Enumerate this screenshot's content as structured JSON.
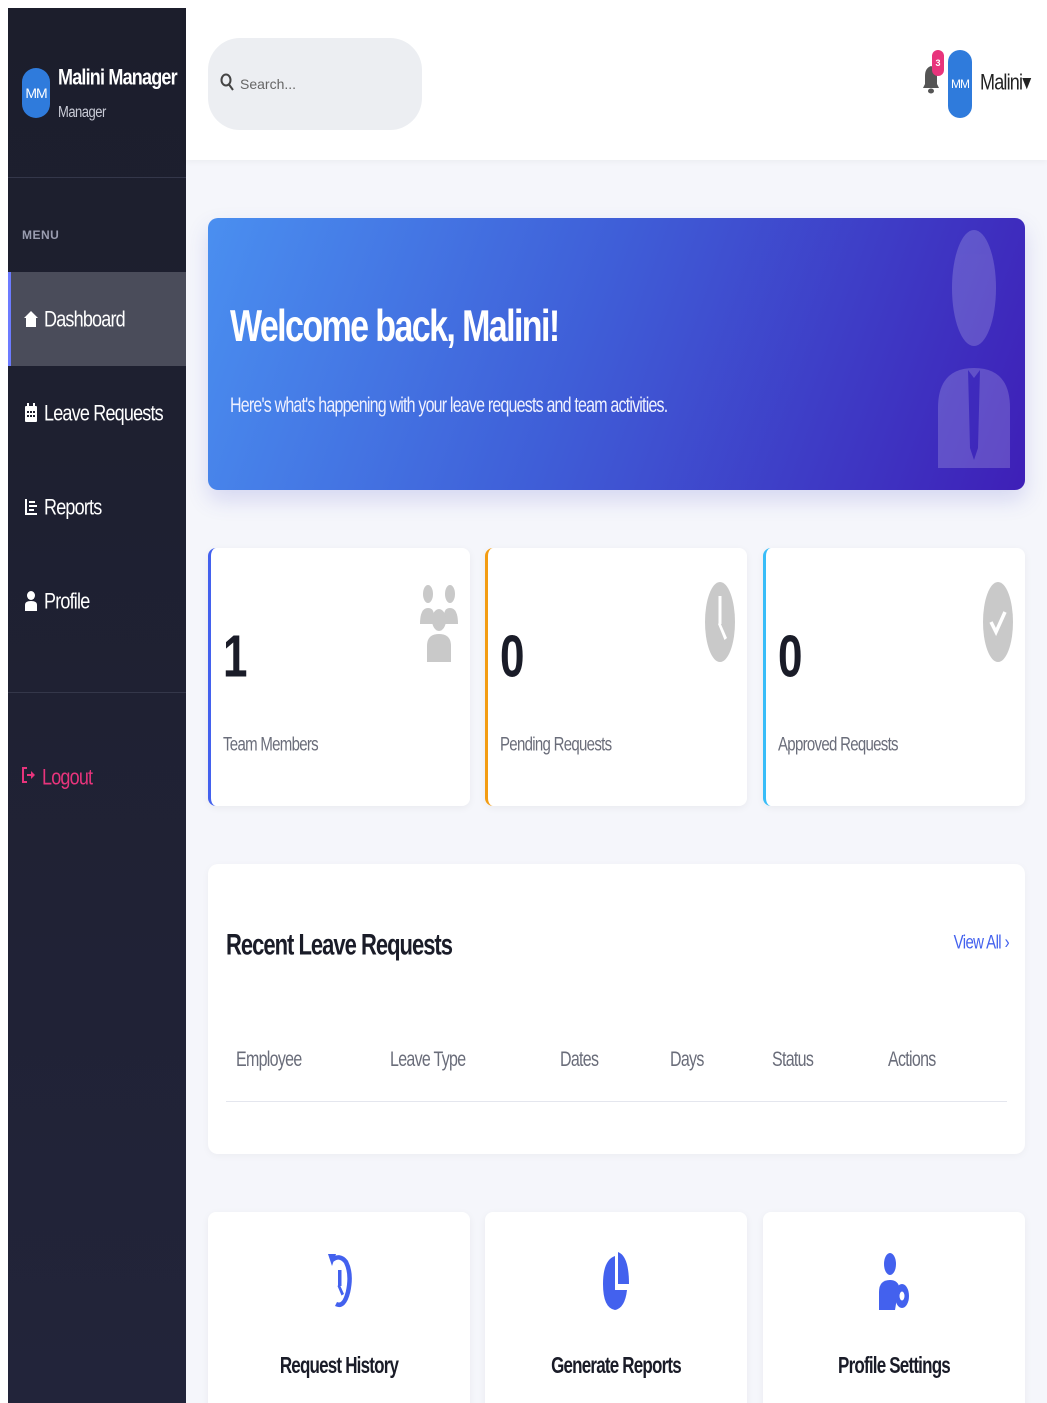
{
  "sidebar": {
    "avatar_initials": "MM",
    "user_name": "Malini Manager",
    "user_role": "Manager",
    "menu_title": "MENU",
    "items": [
      {
        "label": "Dashboard",
        "icon": "home-icon",
        "active": true
      },
      {
        "label": "Leave Requests",
        "icon": "calendar-icon",
        "active": false
      },
      {
        "label": "Reports",
        "icon": "list-icon",
        "active": false
      },
      {
        "label": "Profile",
        "icon": "user-icon",
        "active": false
      }
    ],
    "logout_label": "Logout"
  },
  "header": {
    "search_placeholder": "Search...",
    "notification_count": "3",
    "avatar_initials": "MM",
    "user_short_name": "Malini",
    "dropdown_caret": "▾"
  },
  "banner": {
    "title": "Welcome back, Malini!",
    "subtitle": "Here's what's happening with your leave requests and team activities."
  },
  "stats": [
    {
      "value": "1",
      "label": "Team Members",
      "icon": "users-icon",
      "accent": "#4361ee"
    },
    {
      "value": "0",
      "label": "Pending Requests",
      "icon": "clock-icon",
      "accent": "#f39c12"
    },
    {
      "value": "0",
      "label": "Approved Requests",
      "icon": "check-circle-icon",
      "accent": "#38bdf8"
    }
  ],
  "recent": {
    "title": "Recent Leave Requests",
    "view_all": "View All ›",
    "columns": [
      "Employee",
      "Leave Type",
      "Dates",
      "Days",
      "Status",
      "Actions"
    ]
  },
  "quick_actions": [
    {
      "label": "Request History",
      "icon": "history-icon"
    },
    {
      "label": "Generate Reports",
      "icon": "pie-chart-icon"
    },
    {
      "label": "Profile Settings",
      "icon": "user-cog-icon"
    }
  ],
  "colors": {
    "accent": "#4361ee",
    "sidebar_bg": "#1c1e2c",
    "logout": "#e8347c",
    "banner_start": "#4a8ff0",
    "banner_end": "#3e1fb7"
  }
}
